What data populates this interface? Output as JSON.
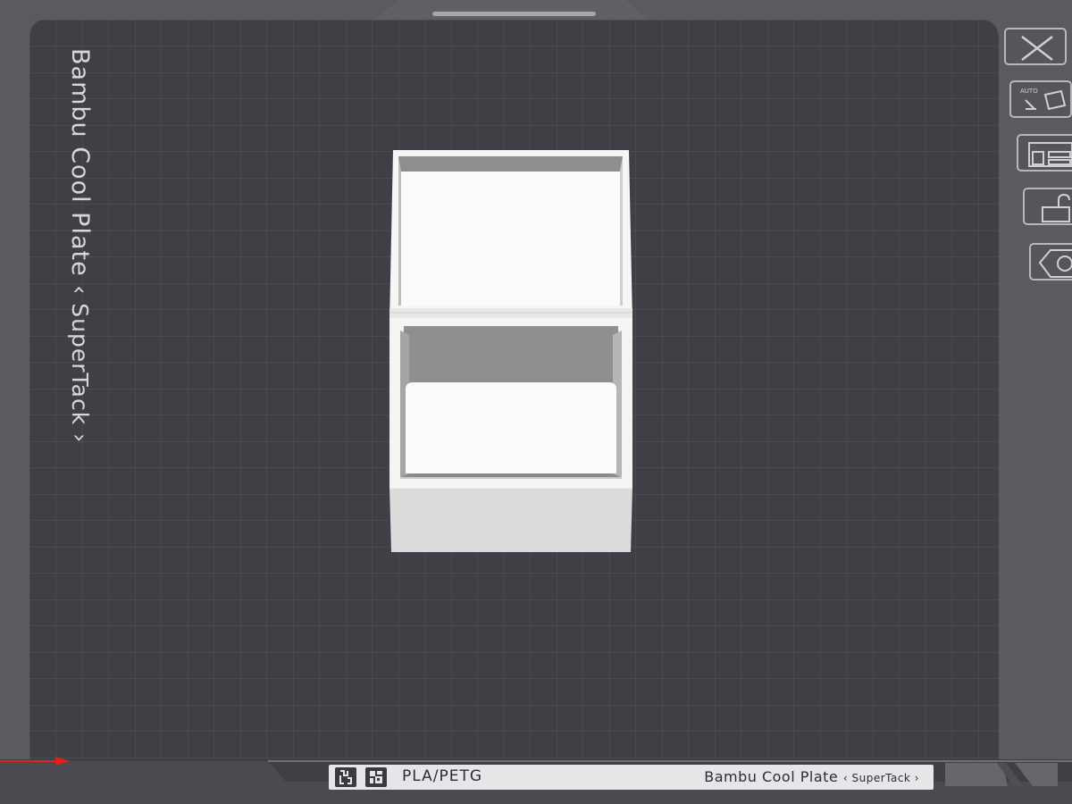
{
  "plate": {
    "label": "Bambu Cool Plate",
    "label_sub": "‹ SuperTack ›"
  },
  "toolbar": {
    "items": [
      {
        "icon": "close-icon"
      },
      {
        "icon": "auto-orient-icon",
        "text": "AUTO"
      },
      {
        "icon": "arrange-icon"
      },
      {
        "icon": "lock-icon"
      },
      {
        "icon": "plate-settings-icon"
      }
    ]
  },
  "info_bar": {
    "filament": "PLA/PETG",
    "plate_name": "Bambu Cool Plate",
    "plate_sub": "‹ SuperTack ›"
  },
  "colors": {
    "plate": "#3f3f46",
    "grid": "#55555c",
    "frame": "#5b5b61",
    "model": "#f4f4f4",
    "x_axis": "#e0231a"
  }
}
